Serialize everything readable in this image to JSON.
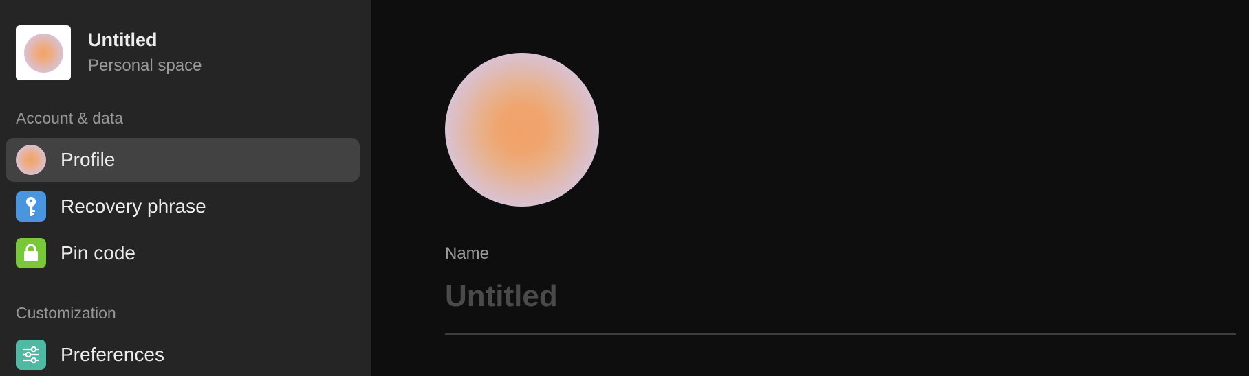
{
  "space": {
    "title": "Untitled",
    "subtitle": "Personal space"
  },
  "sections": {
    "account": "Account & data",
    "customization": "Customization"
  },
  "nav": {
    "profile": "Profile",
    "recovery": "Recovery phrase",
    "pin": "Pin code",
    "preferences": "Preferences"
  },
  "profile": {
    "name_label": "Name",
    "name_value": "",
    "name_placeholder": "Untitled"
  },
  "colors": {
    "sidebar_bg": "#252525",
    "main_bg": "#0e0e0e",
    "active_item_bg": "#424242",
    "recovery_icon": "#4a95e0",
    "pin_icon": "#79c83a",
    "preferences_icon": "#4fb9a4",
    "avatar_core": "#f0a268",
    "avatar_edge": "#d2cef4"
  },
  "icons": {
    "recovery": "key-icon",
    "pin": "lock-icon",
    "preferences": "sliders-icon"
  }
}
